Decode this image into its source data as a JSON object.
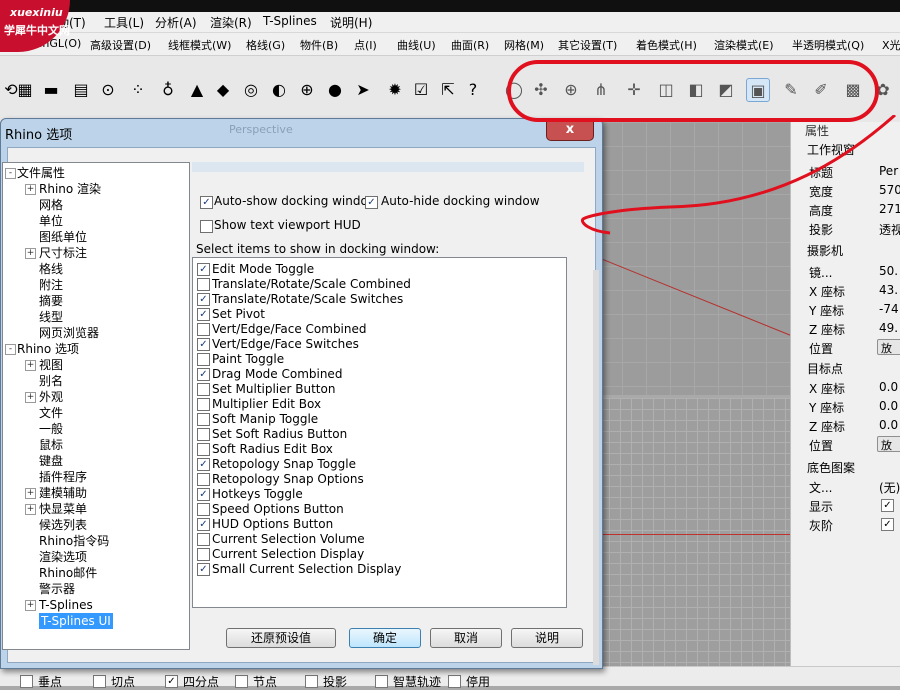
{
  "menu_row1": [
    "变动(T)",
    "工具(L)",
    "分析(A)",
    "渲染(R)",
    "T-Splines",
    "说明(H)"
  ],
  "menu_row2": [
    "OpenGL(O)",
    "高级设置(D)",
    "线框模式(W)",
    "格线(G)",
    "物件(B)",
    "点(I)",
    "曲线(U)",
    "曲面(R)",
    "网格(M)",
    "其它设置(T)",
    "着色模式(H)",
    "渲染模式(E)",
    "半透明模式(Q)",
    "X光"
  ],
  "logo": {
    "line1": "xuexiniu",
    "line2": "学犀牛中文网"
  },
  "viewport_label": "Perspective",
  "dialog": {
    "title": "Rhino 选项",
    "close_glyph": "x",
    "tree": [
      {
        "label": "文件属性",
        "level": 0,
        "toggle": "-"
      },
      {
        "label": "Rhino 渲染",
        "level": 1,
        "toggle": "+"
      },
      {
        "label": "网格",
        "level": 1,
        "toggle": ""
      },
      {
        "label": "单位",
        "level": 1,
        "toggle": ""
      },
      {
        "label": "图纸单位",
        "level": 1,
        "toggle": ""
      },
      {
        "label": "尺寸标注",
        "level": 1,
        "toggle": "+"
      },
      {
        "label": "格线",
        "level": 1,
        "toggle": ""
      },
      {
        "label": "附注",
        "level": 1,
        "toggle": ""
      },
      {
        "label": "摘要",
        "level": 1,
        "toggle": ""
      },
      {
        "label": "线型",
        "level": 1,
        "toggle": ""
      },
      {
        "label": "网页浏览器",
        "level": 1,
        "toggle": ""
      },
      {
        "label": "Rhino 选项",
        "level": 0,
        "toggle": "-"
      },
      {
        "label": "视图",
        "level": 1,
        "toggle": "+"
      },
      {
        "label": "别名",
        "level": 1,
        "toggle": ""
      },
      {
        "label": "外观",
        "level": 1,
        "toggle": "+"
      },
      {
        "label": "文件",
        "level": 1,
        "toggle": ""
      },
      {
        "label": "一般",
        "level": 1,
        "toggle": ""
      },
      {
        "label": "鼠标",
        "level": 1,
        "toggle": ""
      },
      {
        "label": "键盘",
        "level": 1,
        "toggle": ""
      },
      {
        "label": "插件程序",
        "level": 1,
        "toggle": ""
      },
      {
        "label": "建模辅助",
        "level": 1,
        "toggle": "+"
      },
      {
        "label": "快显菜单",
        "level": 1,
        "toggle": "+"
      },
      {
        "label": "候选列表",
        "level": 1,
        "toggle": ""
      },
      {
        "label": "Rhino指令码",
        "level": 1,
        "toggle": ""
      },
      {
        "label": "渲染选项",
        "level": 1,
        "toggle": ""
      },
      {
        "label": "Rhino邮件",
        "level": 1,
        "toggle": ""
      },
      {
        "label": "警示器",
        "level": 1,
        "toggle": ""
      },
      {
        "label": "T-Splines",
        "level": 1,
        "toggle": "+"
      },
      {
        "label": "T-Splines UI",
        "level": 1,
        "toggle": "",
        "selected": true
      }
    ],
    "auto_show": {
      "label": "Auto-show docking window",
      "checked": true
    },
    "auto_hide": {
      "label": "Auto-hide docking window",
      "checked": true
    },
    "show_hud": {
      "label": "Show text viewport HUD",
      "checked": false
    },
    "list_caption": "Select items to show in docking window:",
    "items": [
      {
        "label": "Edit Mode Toggle",
        "checked": true
      },
      {
        "label": "Translate/Rotate/Scale Combined",
        "checked": false
      },
      {
        "label": "Translate/Rotate/Scale Switches",
        "checked": true
      },
      {
        "label": "Set Pivot",
        "checked": true
      },
      {
        "label": "Vert/Edge/Face Combined",
        "checked": false
      },
      {
        "label": "Vert/Edge/Face Switches",
        "checked": true
      },
      {
        "label": "Paint Toggle",
        "checked": false
      },
      {
        "label": "Drag Mode Combined",
        "checked": true
      },
      {
        "label": "Set Multiplier Button",
        "checked": false
      },
      {
        "label": "Multiplier Edit Box",
        "checked": false
      },
      {
        "label": "Soft Manip Toggle",
        "checked": false
      },
      {
        "label": "Set Soft Radius Button",
        "checked": false
      },
      {
        "label": "Soft Radius Edit Box",
        "checked": false
      },
      {
        "label": "Retopology Snap Toggle",
        "checked": true
      },
      {
        "label": "Retopology Snap Options",
        "checked": false
      },
      {
        "label": "Hotkeys Toggle",
        "checked": true
      },
      {
        "label": "Speed Options Button",
        "checked": false
      },
      {
        "label": "HUD Options Button",
        "checked": true
      },
      {
        "label": "Current Selection Volume",
        "checked": false
      },
      {
        "label": "Current Selection Display",
        "checked": false
      },
      {
        "label": "Small Current Selection Display",
        "checked": true
      }
    ],
    "buttons": {
      "restore": "还原预设值",
      "ok": "确定",
      "cancel": "取消",
      "help": "说明"
    }
  },
  "properties": {
    "header": "属性",
    "section_viewport": "工作视窗",
    "rows_viewport": [
      {
        "label": "标题",
        "value": "Per"
      },
      {
        "label": "宽度",
        "value": "570"
      },
      {
        "label": "高度",
        "value": "271"
      },
      {
        "label": "投影",
        "value": "透视"
      }
    ],
    "section_camera": "摄影机",
    "rows_camera": [
      {
        "label": "镜...",
        "value": "50."
      },
      {
        "label": "X 座标",
        "value": "43."
      },
      {
        "label": "Y 座标",
        "value": "-74"
      },
      {
        "label": "Z 座标",
        "value": "49."
      },
      {
        "label": "位置",
        "value": "放"
      }
    ],
    "section_target": "目标点",
    "rows_target": [
      {
        "label": "X 座标",
        "value": "0.0"
      },
      {
        "label": "Y 座标",
        "value": "0.0"
      },
      {
        "label": "Z 座标",
        "value": "0.0"
      },
      {
        "label": "位置",
        "value": "放"
      }
    ],
    "section_wallpaper": "底色图案",
    "rows_wallpaper": [
      {
        "label": "文...",
        "value": "(无)"
      },
      {
        "label": "显示",
        "checked": true
      },
      {
        "label": "灰阶",
        "checked": true
      }
    ]
  },
  "statusbar": [
    {
      "label": "垂点",
      "checked": false
    },
    {
      "label": "切点",
      "checked": false
    },
    {
      "label": "四分点",
      "checked": true
    },
    {
      "label": "节点",
      "checked": false
    },
    {
      "label": "投影",
      "checked": false
    },
    {
      "label": "智慧轨迹",
      "checked": false
    },
    {
      "label": "停用",
      "checked": false
    }
  ],
  "colors": {
    "annotation_red": "#e0101e",
    "selection_blue": "#3399ff",
    "dialog_frame": "#bcd3ea"
  }
}
